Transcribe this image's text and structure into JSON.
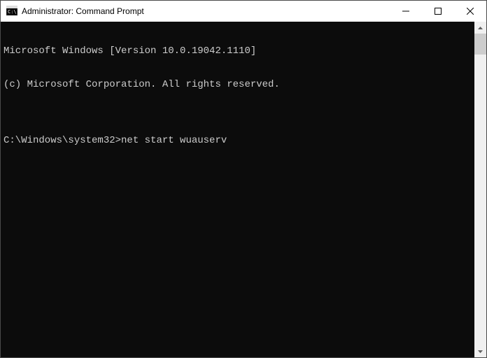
{
  "window": {
    "title": "Administrator: Command Prompt"
  },
  "console": {
    "line1": "Microsoft Windows [Version 10.0.19042.1110]",
    "line2": "(c) Microsoft Corporation. All rights reserved.",
    "blank": "",
    "prompt": "C:\\Windows\\system32>",
    "command": "net start wuauserv"
  }
}
